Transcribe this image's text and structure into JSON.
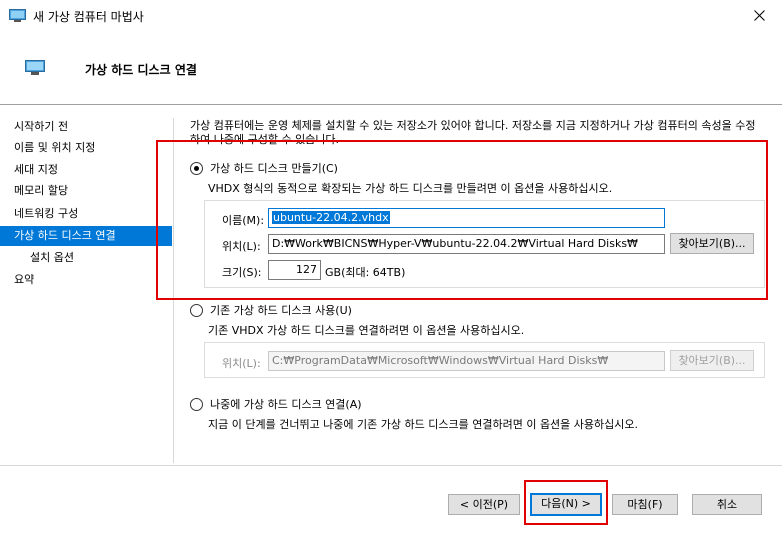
{
  "window": {
    "title": "새 가상 컴퓨터 마법사",
    "icon": "monitor-icon",
    "close_icon": "close-icon"
  },
  "header": {
    "title": "가상 하드 디스크 연결",
    "icon": "monitor-icon"
  },
  "sidebar": {
    "items": [
      {
        "label": "시작하기 전",
        "active": false
      },
      {
        "label": "이름 및 위치 지정",
        "active": false
      },
      {
        "label": "세대 지정",
        "active": false
      },
      {
        "label": "메모리 할당",
        "active": false
      },
      {
        "label": "네트워킹 구성",
        "active": false
      },
      {
        "label": "가상 하드 디스크 연결",
        "active": true
      },
      {
        "label": "설치 옵션",
        "active": false
      },
      {
        "label": "요약",
        "active": false
      }
    ]
  },
  "main": {
    "intro": "가상 컴퓨터에는 운영 체제를 설치할 수 있는 저장소가 있어야 합니다. 저장소를 지금 지정하거나 가상 컴퓨터의 속성을 수정하여 나중에 구성할 수 있습니다.",
    "create": {
      "radio_label": "가상 하드 디스크 만들기(C)",
      "checked": true,
      "description": "VHDX 형식의 동적으로 확장되는 가상 하드 디스크를 만들려면 이 옵션을 사용하십시오.",
      "name_label": "이름(M):",
      "name_value": "ubuntu-22.04.2.vhdx",
      "location_label": "위치(L):",
      "location_value": "D:₩Work₩BICNS₩Hyper-V₩ubuntu-22.04.2₩Virtual Hard Disks₩",
      "browse_label": "찾아보기(B)...",
      "size_label": "크기(S):",
      "size_value": "127",
      "size_unit": "GB(최대: 64TB)"
    },
    "existing": {
      "radio_label": "기존 가상 하드 디스크 사용(U)",
      "checked": false,
      "description": "기존 VHDX 가상 하드 디스크를 연결하려면 이 옵션을 사용하십시오.",
      "location_label": "위치(L):",
      "location_value": "C:₩ProgramData₩Microsoft₩Windows₩Virtual Hard Disks₩",
      "browse_label": "찾아보기(B)..."
    },
    "later": {
      "radio_label": "나중에 가상 하드 디스크 연결(A)",
      "checked": false,
      "description": "지금 이 단계를 건너뛰고 나중에 기존 가상 하드 디스크를 연결하려면 이 옵션을 사용하십시오."
    }
  },
  "footer": {
    "prev_label": "< 이전(P)",
    "next_label": "다음(N) >",
    "finish_label": "마침(F)",
    "cancel_label": "취소"
  },
  "colors": {
    "accent": "#0078d7",
    "highlight": "#e00000"
  }
}
